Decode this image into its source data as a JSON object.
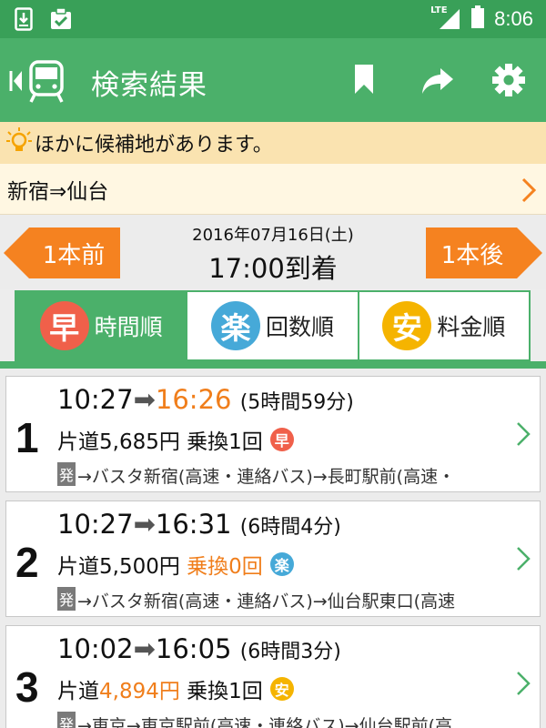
{
  "status": {
    "network": "LTE",
    "time": "8:06"
  },
  "appbar": {
    "title": "検索結果"
  },
  "notice": {
    "text": "ほかに候補地があります。"
  },
  "route": {
    "text": "新宿⇒仙台"
  },
  "datebar": {
    "prev_label": "1本前",
    "next_label": "1本後",
    "date": "2016年07月16日(土)",
    "arrival": "17:00到着"
  },
  "tabs": [
    {
      "icon_char": "早",
      "label": "時間順",
      "color": "#f0604a"
    },
    {
      "icon_char": "楽",
      "label": "回数順",
      "color": "#46a9d8"
    },
    {
      "icon_char": "安",
      "label": "料金順",
      "color": "#f5b400"
    }
  ],
  "results": [
    {
      "rank": "1",
      "dep": "10:27",
      "arrow": "➡",
      "arr": "16:26",
      "duration": "(5時間59分)",
      "fare": "片道5,685円",
      "transfer": "乗換1回",
      "badge": "早",
      "badge_color": "#f0604a",
      "hatsu": "発",
      "route": "→バスタ新宿(高速・連絡バス)→長町駅前(高速・"
    },
    {
      "rank": "2",
      "dep": "10:27",
      "arrow": "➡",
      "arr": "16:31",
      "duration": "(6時間4分)",
      "fare": "片道5,500円",
      "transfer": "乗換0回",
      "badge": "楽",
      "badge_color": "#46a9d8",
      "hatsu": "発",
      "route": "→バスタ新宿(高速・連絡バス)→仙台駅東口(高速"
    },
    {
      "rank": "3",
      "dep": "10:02",
      "arrow": "➡",
      "arr": "16:05",
      "duration": "(6時間3分)",
      "fare_prefix": "片道",
      "fare_value": "4,894円",
      "transfer": "乗換1回",
      "badge": "安",
      "badge_color": "#f5b400",
      "hatsu": "発",
      "route": "→東京→東京駅前(高速・連絡バス)→仙台駅前(高"
    }
  ]
}
